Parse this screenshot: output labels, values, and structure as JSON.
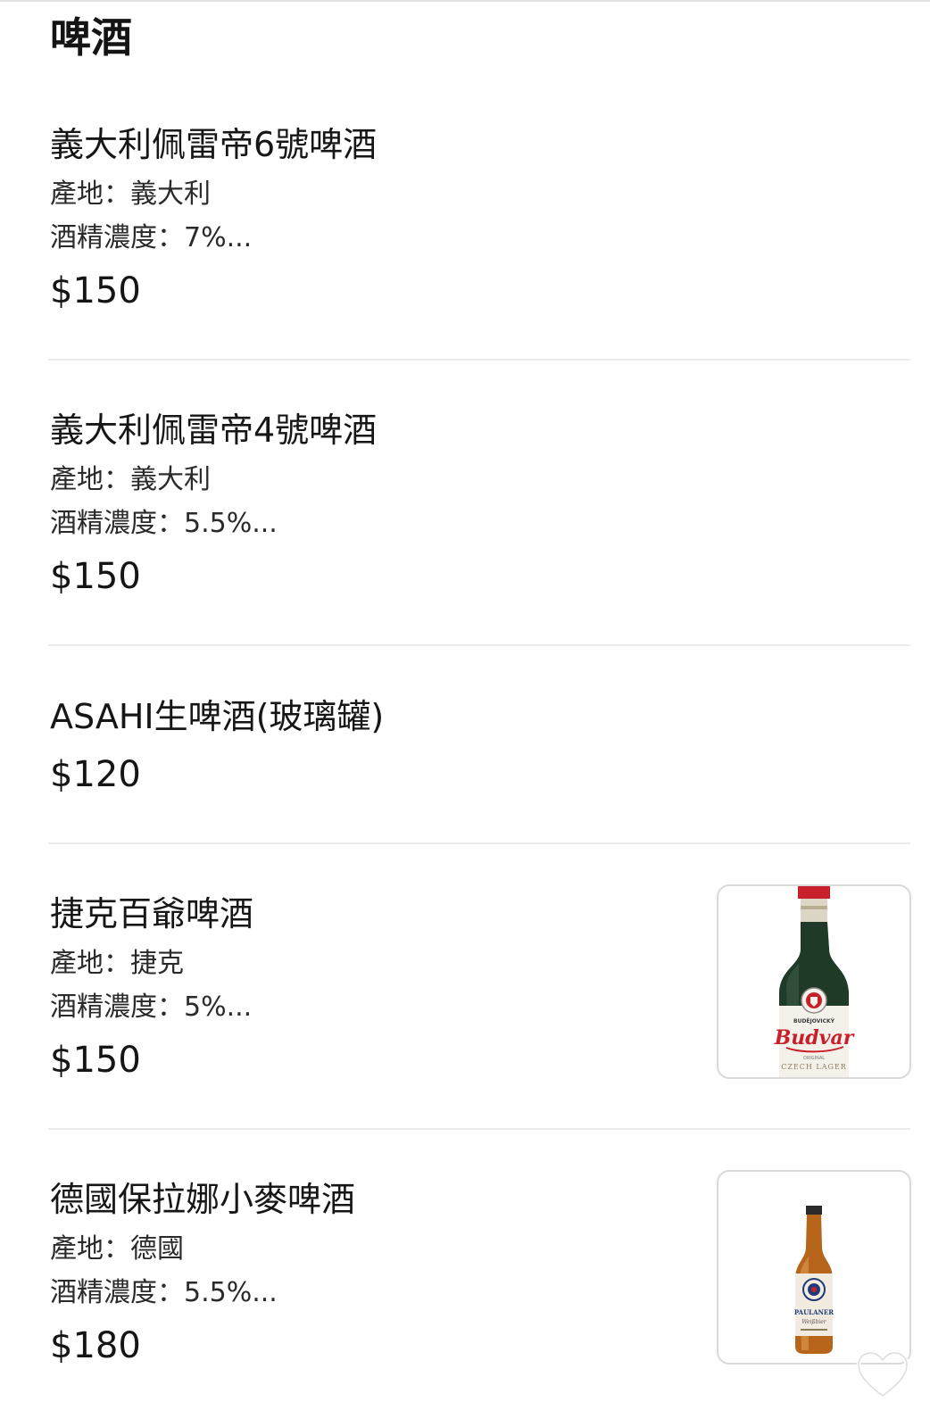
{
  "section": {
    "title": "啤酒"
  },
  "items": [
    {
      "name": "義大利佩雷帝6號啤酒",
      "origin": "產地：義大利",
      "abv": "酒精濃度：7%...",
      "price": "$150"
    },
    {
      "name": "義大利佩雷帝4號啤酒",
      "origin": "產地：義大利",
      "abv": "酒精濃度：5.5%...",
      "price": "$150"
    },
    {
      "name": "ASAHI生啤酒(玻璃罐)",
      "price": "$120"
    },
    {
      "name": "捷克百爺啤酒",
      "origin": "產地：捷克",
      "abv": "酒精濃度：5%...",
      "price": "$150",
      "image": {
        "icon": "green-beer-bottle",
        "label_top": "BUDĚJOVICKÝ",
        "brand": "Budvar",
        "label_sub": "ORIGINAL",
        "label_bottom": "CZECH LAGER"
      }
    },
    {
      "name": "德國保拉娜小麥啤酒",
      "origin": "產地：德國",
      "abv": "酒精濃度：5.5%...",
      "price": "$180",
      "image": {
        "icon": "amber-beer-bottle",
        "brand": "PAULANER",
        "label_sub": "Weißbier"
      }
    }
  ],
  "colors": {
    "text": "#161616",
    "divider": "#ececec",
    "thumb_border": "#d9d9d9",
    "budvar_green": "#1f3a26",
    "budvar_red": "#c8202a",
    "paulaner_amber": "#b8651c"
  },
  "icons": {
    "favorite": "heart-icon"
  }
}
